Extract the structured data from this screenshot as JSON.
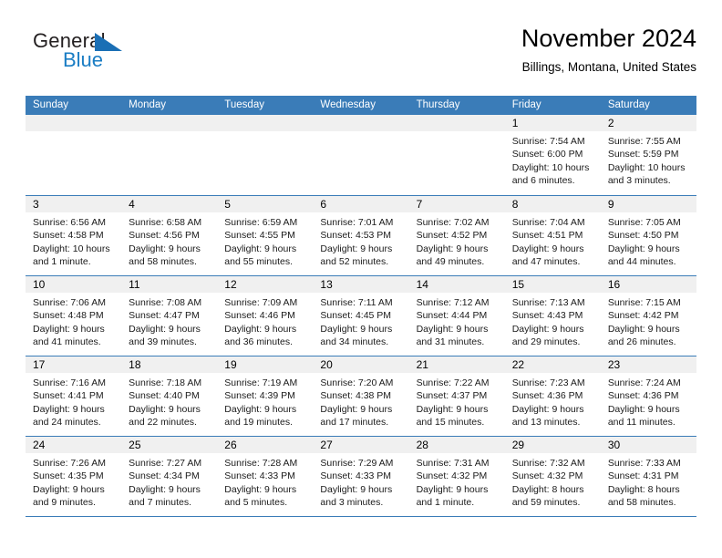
{
  "brand": {
    "name_part1": "General",
    "name_part2": "Blue",
    "triangle_color": "#1a6fb5",
    "blue_text_color": "#1a7dc4"
  },
  "header": {
    "title": "November 2024",
    "subtitle": "Billings, Montana, United States"
  },
  "theme": {
    "header_blue": "#3a7cb8",
    "date_band_gray": "#f0f0f0",
    "cell_background": "#ffffff"
  },
  "calendar": {
    "weekday_headers": [
      "Sunday",
      "Monday",
      "Tuesday",
      "Wednesday",
      "Thursday",
      "Friday",
      "Saturday"
    ],
    "weeks": [
      [
        {
          "date": "",
          "sunrise": "",
          "sunset": "",
          "daylight_line1": "",
          "daylight_line2": ""
        },
        {
          "date": "",
          "sunrise": "",
          "sunset": "",
          "daylight_line1": "",
          "daylight_line2": ""
        },
        {
          "date": "",
          "sunrise": "",
          "sunset": "",
          "daylight_line1": "",
          "daylight_line2": ""
        },
        {
          "date": "",
          "sunrise": "",
          "sunset": "",
          "daylight_line1": "",
          "daylight_line2": ""
        },
        {
          "date": "",
          "sunrise": "",
          "sunset": "",
          "daylight_line1": "",
          "daylight_line2": ""
        },
        {
          "date": "1",
          "sunrise": "Sunrise: 7:54 AM",
          "sunset": "Sunset: 6:00 PM",
          "daylight_line1": "Daylight: 10 hours",
          "daylight_line2": "and 6 minutes."
        },
        {
          "date": "2",
          "sunrise": "Sunrise: 7:55 AM",
          "sunset": "Sunset: 5:59 PM",
          "daylight_line1": "Daylight: 10 hours",
          "daylight_line2": "and 3 minutes."
        }
      ],
      [
        {
          "date": "3",
          "sunrise": "Sunrise: 6:56 AM",
          "sunset": "Sunset: 4:58 PM",
          "daylight_line1": "Daylight: 10 hours",
          "daylight_line2": "and 1 minute."
        },
        {
          "date": "4",
          "sunrise": "Sunrise: 6:58 AM",
          "sunset": "Sunset: 4:56 PM",
          "daylight_line1": "Daylight: 9 hours",
          "daylight_line2": "and 58 minutes."
        },
        {
          "date": "5",
          "sunrise": "Sunrise: 6:59 AM",
          "sunset": "Sunset: 4:55 PM",
          "daylight_line1": "Daylight: 9 hours",
          "daylight_line2": "and 55 minutes."
        },
        {
          "date": "6",
          "sunrise": "Sunrise: 7:01 AM",
          "sunset": "Sunset: 4:53 PM",
          "daylight_line1": "Daylight: 9 hours",
          "daylight_line2": "and 52 minutes."
        },
        {
          "date": "7",
          "sunrise": "Sunrise: 7:02 AM",
          "sunset": "Sunset: 4:52 PM",
          "daylight_line1": "Daylight: 9 hours",
          "daylight_line2": "and 49 minutes."
        },
        {
          "date": "8",
          "sunrise": "Sunrise: 7:04 AM",
          "sunset": "Sunset: 4:51 PM",
          "daylight_line1": "Daylight: 9 hours",
          "daylight_line2": "and 47 minutes."
        },
        {
          "date": "9",
          "sunrise": "Sunrise: 7:05 AM",
          "sunset": "Sunset: 4:50 PM",
          "daylight_line1": "Daylight: 9 hours",
          "daylight_line2": "and 44 minutes."
        }
      ],
      [
        {
          "date": "10",
          "sunrise": "Sunrise: 7:06 AM",
          "sunset": "Sunset: 4:48 PM",
          "daylight_line1": "Daylight: 9 hours",
          "daylight_line2": "and 41 minutes."
        },
        {
          "date": "11",
          "sunrise": "Sunrise: 7:08 AM",
          "sunset": "Sunset: 4:47 PM",
          "daylight_line1": "Daylight: 9 hours",
          "daylight_line2": "and 39 minutes."
        },
        {
          "date": "12",
          "sunrise": "Sunrise: 7:09 AM",
          "sunset": "Sunset: 4:46 PM",
          "daylight_line1": "Daylight: 9 hours",
          "daylight_line2": "and 36 minutes."
        },
        {
          "date": "13",
          "sunrise": "Sunrise: 7:11 AM",
          "sunset": "Sunset: 4:45 PM",
          "daylight_line1": "Daylight: 9 hours",
          "daylight_line2": "and 34 minutes."
        },
        {
          "date": "14",
          "sunrise": "Sunrise: 7:12 AM",
          "sunset": "Sunset: 4:44 PM",
          "daylight_line1": "Daylight: 9 hours",
          "daylight_line2": "and 31 minutes."
        },
        {
          "date": "15",
          "sunrise": "Sunrise: 7:13 AM",
          "sunset": "Sunset: 4:43 PM",
          "daylight_line1": "Daylight: 9 hours",
          "daylight_line2": "and 29 minutes."
        },
        {
          "date": "16",
          "sunrise": "Sunrise: 7:15 AM",
          "sunset": "Sunset: 4:42 PM",
          "daylight_line1": "Daylight: 9 hours",
          "daylight_line2": "and 26 minutes."
        }
      ],
      [
        {
          "date": "17",
          "sunrise": "Sunrise: 7:16 AM",
          "sunset": "Sunset: 4:41 PM",
          "daylight_line1": "Daylight: 9 hours",
          "daylight_line2": "and 24 minutes."
        },
        {
          "date": "18",
          "sunrise": "Sunrise: 7:18 AM",
          "sunset": "Sunset: 4:40 PM",
          "daylight_line1": "Daylight: 9 hours",
          "daylight_line2": "and 22 minutes."
        },
        {
          "date": "19",
          "sunrise": "Sunrise: 7:19 AM",
          "sunset": "Sunset: 4:39 PM",
          "daylight_line1": "Daylight: 9 hours",
          "daylight_line2": "and 19 minutes."
        },
        {
          "date": "20",
          "sunrise": "Sunrise: 7:20 AM",
          "sunset": "Sunset: 4:38 PM",
          "daylight_line1": "Daylight: 9 hours",
          "daylight_line2": "and 17 minutes."
        },
        {
          "date": "21",
          "sunrise": "Sunrise: 7:22 AM",
          "sunset": "Sunset: 4:37 PM",
          "daylight_line1": "Daylight: 9 hours",
          "daylight_line2": "and 15 minutes."
        },
        {
          "date": "22",
          "sunrise": "Sunrise: 7:23 AM",
          "sunset": "Sunset: 4:36 PM",
          "daylight_line1": "Daylight: 9 hours",
          "daylight_line2": "and 13 minutes."
        },
        {
          "date": "23",
          "sunrise": "Sunrise: 7:24 AM",
          "sunset": "Sunset: 4:36 PM",
          "daylight_line1": "Daylight: 9 hours",
          "daylight_line2": "and 11 minutes."
        }
      ],
      [
        {
          "date": "24",
          "sunrise": "Sunrise: 7:26 AM",
          "sunset": "Sunset: 4:35 PM",
          "daylight_line1": "Daylight: 9 hours",
          "daylight_line2": "and 9 minutes."
        },
        {
          "date": "25",
          "sunrise": "Sunrise: 7:27 AM",
          "sunset": "Sunset: 4:34 PM",
          "daylight_line1": "Daylight: 9 hours",
          "daylight_line2": "and 7 minutes."
        },
        {
          "date": "26",
          "sunrise": "Sunrise: 7:28 AM",
          "sunset": "Sunset: 4:33 PM",
          "daylight_line1": "Daylight: 9 hours",
          "daylight_line2": "and 5 minutes."
        },
        {
          "date": "27",
          "sunrise": "Sunrise: 7:29 AM",
          "sunset": "Sunset: 4:33 PM",
          "daylight_line1": "Daylight: 9 hours",
          "daylight_line2": "and 3 minutes."
        },
        {
          "date": "28",
          "sunrise": "Sunrise: 7:31 AM",
          "sunset": "Sunset: 4:32 PM",
          "daylight_line1": "Daylight: 9 hours",
          "daylight_line2": "and 1 minute."
        },
        {
          "date": "29",
          "sunrise": "Sunrise: 7:32 AM",
          "sunset": "Sunset: 4:32 PM",
          "daylight_line1": "Daylight: 8 hours",
          "daylight_line2": "and 59 minutes."
        },
        {
          "date": "30",
          "sunrise": "Sunrise: 7:33 AM",
          "sunset": "Sunset: 4:31 PM",
          "daylight_line1": "Daylight: 8 hours",
          "daylight_line2": "and 58 minutes."
        }
      ]
    ]
  }
}
